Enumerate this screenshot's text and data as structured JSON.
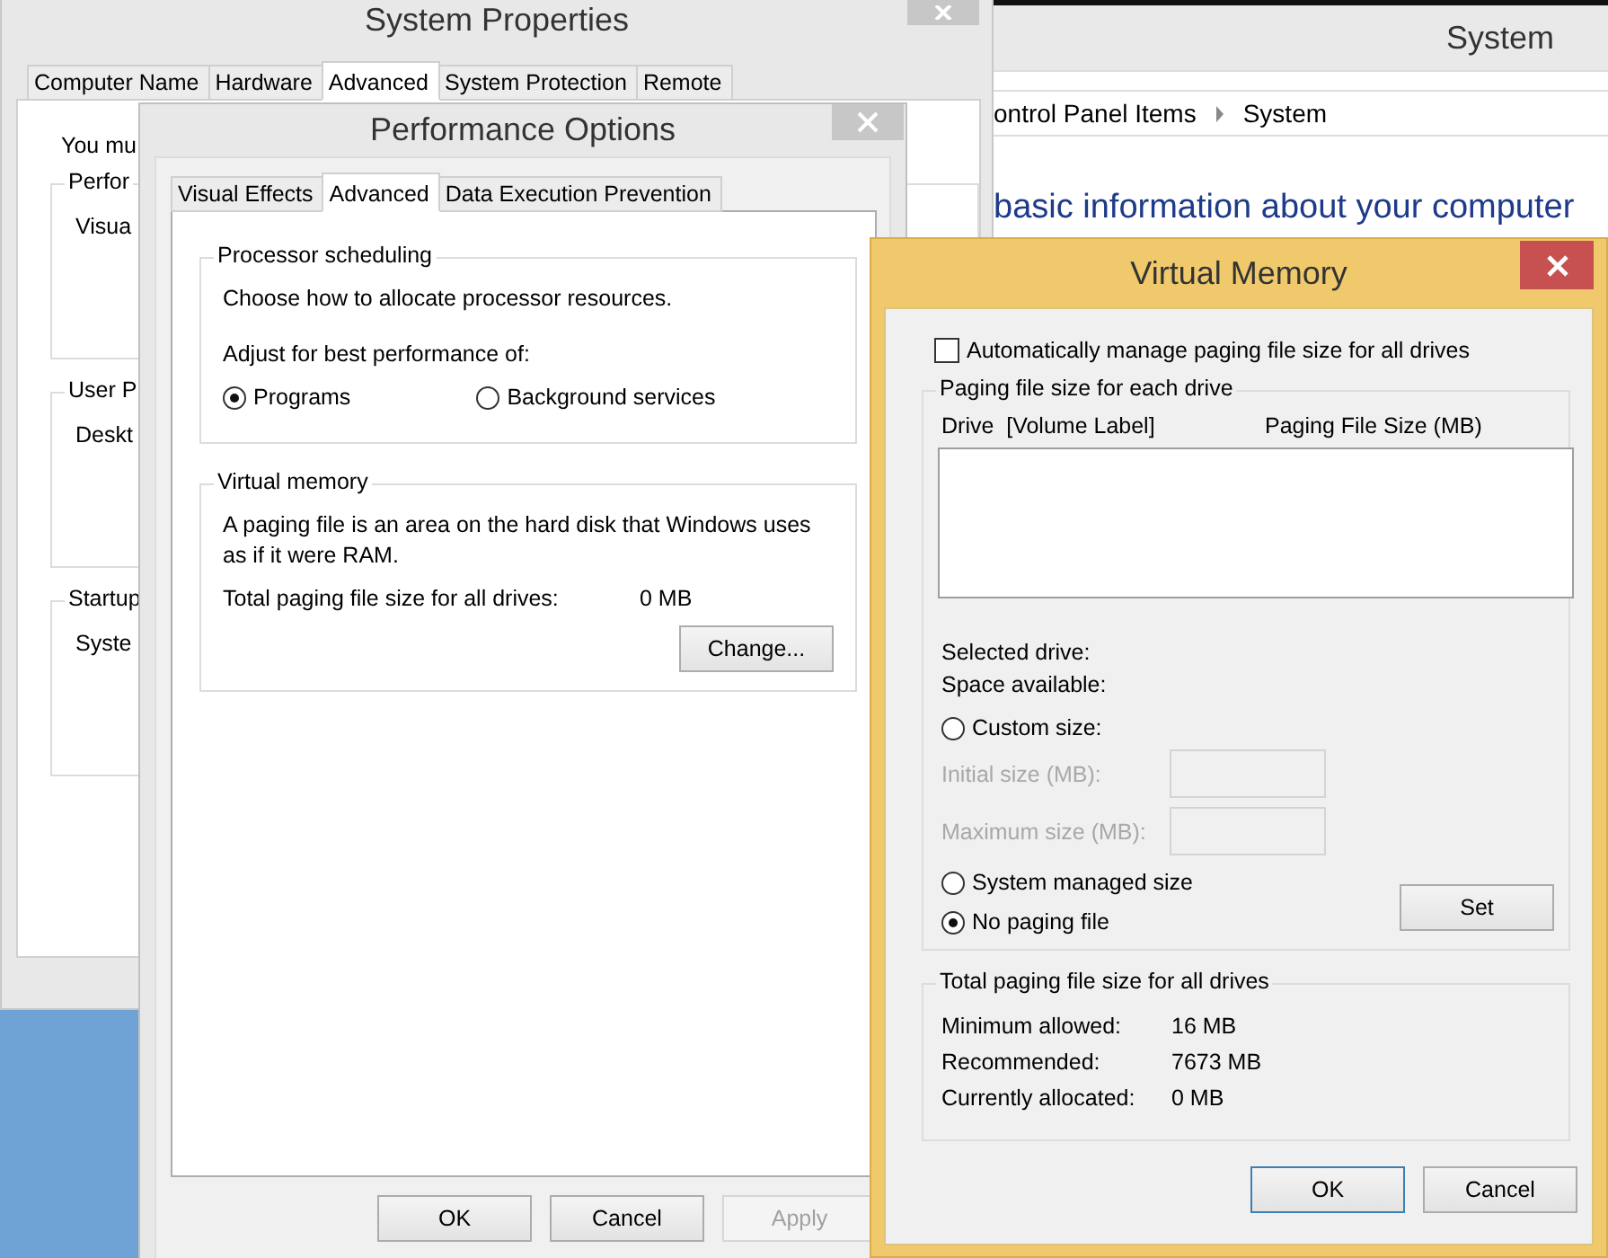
{
  "system_window": {
    "title": "System",
    "breadcrumb": [
      "ontrol Panel Items",
      "System"
    ],
    "heading": "basic information about your computer"
  },
  "system_properties": {
    "title": "System Properties",
    "tabs": [
      {
        "label": "Computer Name",
        "selected": false
      },
      {
        "label": "Hardware",
        "selected": false
      },
      {
        "label": "Advanced",
        "selected": true
      },
      {
        "label": "System Protection",
        "selected": false
      },
      {
        "label": "Remote",
        "selected": false
      }
    ],
    "intro": "You mu",
    "groups": [
      {
        "title": "Perfor",
        "text": "Visua"
      },
      {
        "title": "User P",
        "text": "Deskt"
      },
      {
        "title": "Startup",
        "text": "Syste"
      }
    ]
  },
  "performance_options": {
    "title": "Performance Options",
    "tabs": [
      {
        "label": "Visual Effects",
        "selected": false
      },
      {
        "label": "Advanced",
        "selected": true
      },
      {
        "label": "Data Execution Prevention",
        "selected": false
      }
    ],
    "processor_scheduling": {
      "title": "Processor scheduling",
      "description": "Choose how to allocate processor resources.",
      "prompt": "Adjust for best performance of:",
      "options": [
        {
          "label": "Programs",
          "selected": true
        },
        {
          "label": "Background services",
          "selected": false
        }
      ]
    },
    "virtual_memory": {
      "title": "Virtual memory",
      "description": "A paging file is an area on the hard disk that Windows uses as if it were RAM.",
      "total_label": "Total paging file size for all drives:",
      "total_value": "0 MB",
      "button": "Change..."
    },
    "buttons": [
      {
        "label": "OK",
        "disabled": false
      },
      {
        "label": "Cancel",
        "disabled": false
      },
      {
        "label": "Apply",
        "disabled": true
      }
    ]
  },
  "virtual_memory": {
    "title": "Virtual Memory",
    "auto_manage": {
      "label": "Automatically manage paging file size for all drives",
      "checked": false
    },
    "drive_group": {
      "title": "Paging file size for each drive",
      "columns": [
        "Drive  [Volume Label]",
        "Paging File Size (MB)"
      ],
      "selected_drive_label": "Selected drive:",
      "space_available_label": "Space available:",
      "size_options": [
        {
          "label": "Custom size:",
          "selected": false
        },
        {
          "label": "System managed size",
          "selected": false
        },
        {
          "label": "No paging file",
          "selected": true
        }
      ],
      "custom_fields": [
        {
          "label": "Initial size (MB):",
          "disabled": true
        },
        {
          "label": "Maximum size (MB):",
          "disabled": true
        }
      ],
      "set_button": "Set"
    },
    "totals": {
      "title": "Total paging file size for all drives",
      "rows": [
        {
          "label": "Minimum allowed:",
          "value": "16 MB"
        },
        {
          "label": "Recommended:",
          "value": "7673 MB"
        },
        {
          "label": "Currently allocated:",
          "value": "0 MB"
        }
      ]
    },
    "buttons": [
      {
        "label": "OK",
        "default": true
      },
      {
        "label": "Cancel",
        "default": false
      }
    ]
  }
}
